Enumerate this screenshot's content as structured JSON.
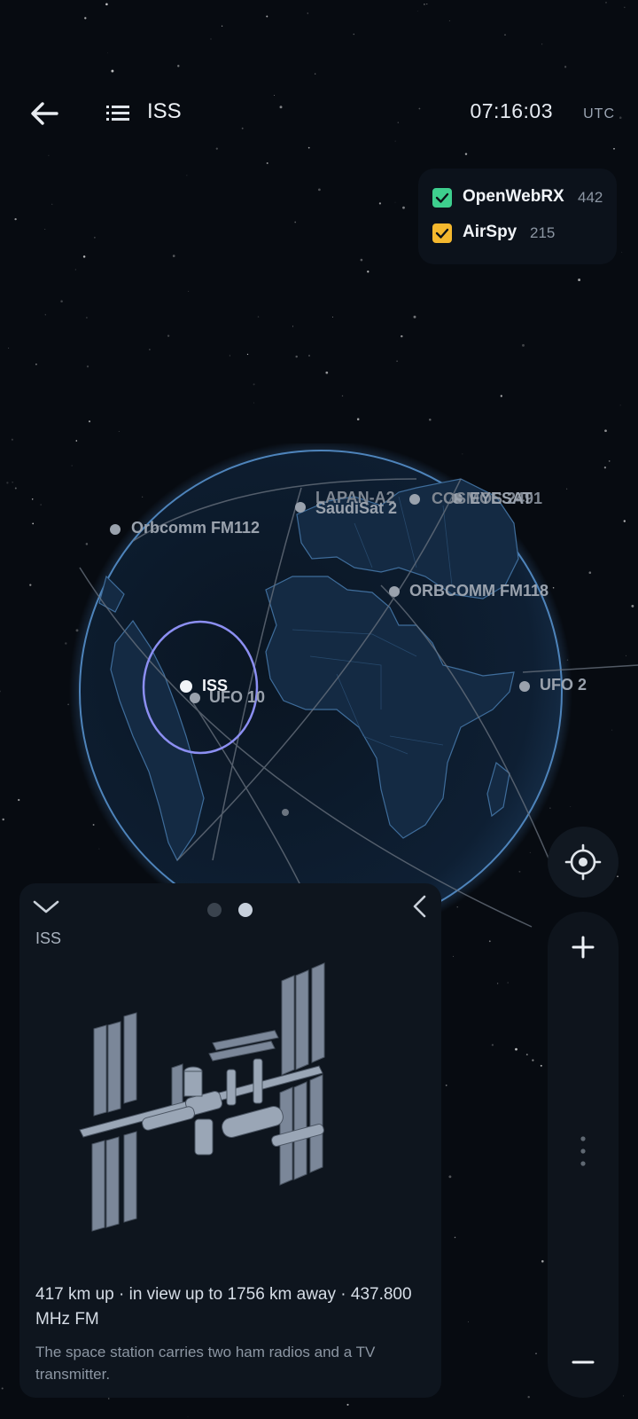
{
  "header": {
    "back_icon": "arrow-left-icon",
    "list_icon": "list-icon",
    "title": "ISS",
    "time": "07:16:03",
    "timezone": "UTC"
  },
  "legend": {
    "items": [
      {
        "name": "OpenWebRX",
        "count": "442",
        "checked": true,
        "color": "#3ecf8e"
      },
      {
        "name": "AirSpy",
        "count": "215",
        "checked": true,
        "color": "#f5b82e"
      }
    ]
  },
  "globe": {
    "satellites": [
      {
        "label": "Orbcomm FM112"
      },
      {
        "label": "LAPAN-A2"
      },
      {
        "label": "SaudiSat 2"
      },
      {
        "label": "COSMOS 2491"
      },
      {
        "label": "EYESAT"
      },
      {
        "label": "ORBCOMM FM118"
      },
      {
        "label": "ISS",
        "selected": true
      },
      {
        "label": "UFO 10"
      },
      {
        "label": "UFO 2"
      }
    ],
    "selection_color": "#8c8ff2"
  },
  "controls": {
    "locate_icon": "crosshair-icon",
    "zoom_in_icon": "plus-icon",
    "zoom_out_icon": "minus-icon",
    "zoom_handle_icon": "drag-handle-icon"
  },
  "card": {
    "collapse_icon": "chevron-down-icon",
    "back_icon": "chevron-left-icon",
    "pages": 2,
    "active_page": 2,
    "name": "ISS",
    "image_icon": "iss-station-icon",
    "stats": "417 km up · in view up to 1756 km away · 437.800 MHz FM",
    "description": "The space station carries two ham radios and a TV transmitter."
  }
}
